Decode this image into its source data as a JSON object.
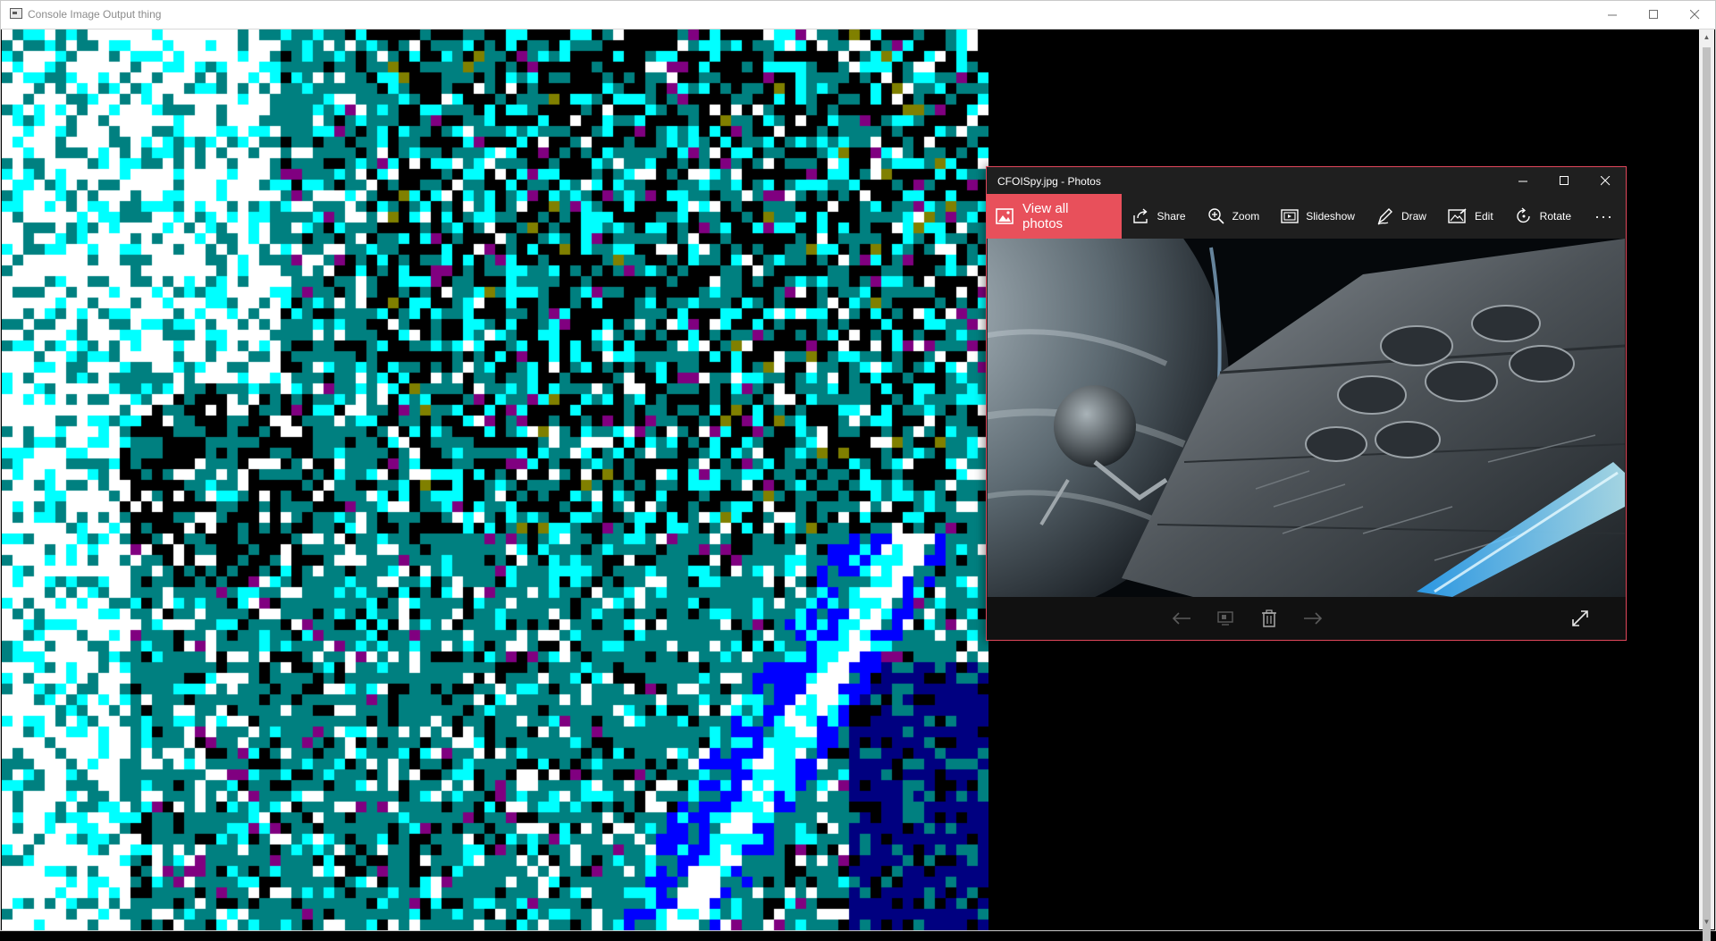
{
  "console": {
    "title": "Console Image Output thing",
    "palette": {
      "black": "#000000",
      "white": "#ffffff",
      "teal": "#008080",
      "cyan": "#00ffff",
      "blue": "#0000ff",
      "navy": "#000080",
      "purple": "#800080",
      "olive": "#808000"
    }
  },
  "photos": {
    "title": "CFOISpy.jpg - Photos",
    "accent": "#e8505b",
    "toolbar": {
      "view_all": "View all photos",
      "share": "Share",
      "zoom": "Zoom",
      "slideshow": "Slideshow",
      "draw": "Draw",
      "edit": "Edit",
      "rotate": "Rotate",
      "more": "···"
    },
    "icons": [
      "photos-icon",
      "share-icon",
      "zoom-icon",
      "slideshow-icon",
      "draw-icon",
      "edit-icon",
      "rotate-icon",
      "more-icon",
      "previous-arrow-icon",
      "slideshow-thumbnail-icon",
      "delete-icon",
      "next-arrow-icon",
      "fullscreen-icon"
    ]
  }
}
